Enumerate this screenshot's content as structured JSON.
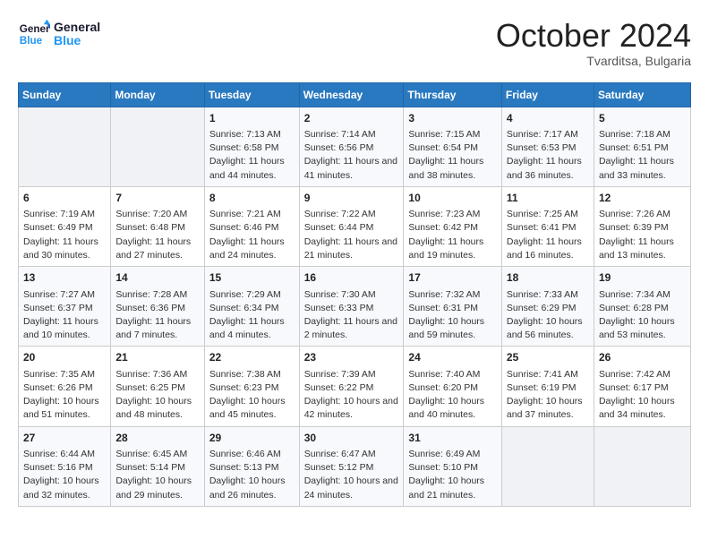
{
  "header": {
    "logo_line1": "General",
    "logo_line2": "Blue",
    "month": "October 2024",
    "location": "Tvarditsa, Bulgaria"
  },
  "weekdays": [
    "Sunday",
    "Monday",
    "Tuesday",
    "Wednesday",
    "Thursday",
    "Friday",
    "Saturday"
  ],
  "weeks": [
    [
      {
        "day": "",
        "info": ""
      },
      {
        "day": "",
        "info": ""
      },
      {
        "day": "1",
        "info": "Sunrise: 7:13 AM\nSunset: 6:58 PM\nDaylight: 11 hours and 44 minutes."
      },
      {
        "day": "2",
        "info": "Sunrise: 7:14 AM\nSunset: 6:56 PM\nDaylight: 11 hours and 41 minutes."
      },
      {
        "day": "3",
        "info": "Sunrise: 7:15 AM\nSunset: 6:54 PM\nDaylight: 11 hours and 38 minutes."
      },
      {
        "day": "4",
        "info": "Sunrise: 7:17 AM\nSunset: 6:53 PM\nDaylight: 11 hours and 36 minutes."
      },
      {
        "day": "5",
        "info": "Sunrise: 7:18 AM\nSunset: 6:51 PM\nDaylight: 11 hours and 33 minutes."
      }
    ],
    [
      {
        "day": "6",
        "info": "Sunrise: 7:19 AM\nSunset: 6:49 PM\nDaylight: 11 hours and 30 minutes."
      },
      {
        "day": "7",
        "info": "Sunrise: 7:20 AM\nSunset: 6:48 PM\nDaylight: 11 hours and 27 minutes."
      },
      {
        "day": "8",
        "info": "Sunrise: 7:21 AM\nSunset: 6:46 PM\nDaylight: 11 hours and 24 minutes."
      },
      {
        "day": "9",
        "info": "Sunrise: 7:22 AM\nSunset: 6:44 PM\nDaylight: 11 hours and 21 minutes."
      },
      {
        "day": "10",
        "info": "Sunrise: 7:23 AM\nSunset: 6:42 PM\nDaylight: 11 hours and 19 minutes."
      },
      {
        "day": "11",
        "info": "Sunrise: 7:25 AM\nSunset: 6:41 PM\nDaylight: 11 hours and 16 minutes."
      },
      {
        "day": "12",
        "info": "Sunrise: 7:26 AM\nSunset: 6:39 PM\nDaylight: 11 hours and 13 minutes."
      }
    ],
    [
      {
        "day": "13",
        "info": "Sunrise: 7:27 AM\nSunset: 6:37 PM\nDaylight: 11 hours and 10 minutes."
      },
      {
        "day": "14",
        "info": "Sunrise: 7:28 AM\nSunset: 6:36 PM\nDaylight: 11 hours and 7 minutes."
      },
      {
        "day": "15",
        "info": "Sunrise: 7:29 AM\nSunset: 6:34 PM\nDaylight: 11 hours and 4 minutes."
      },
      {
        "day": "16",
        "info": "Sunrise: 7:30 AM\nSunset: 6:33 PM\nDaylight: 11 hours and 2 minutes."
      },
      {
        "day": "17",
        "info": "Sunrise: 7:32 AM\nSunset: 6:31 PM\nDaylight: 10 hours and 59 minutes."
      },
      {
        "day": "18",
        "info": "Sunrise: 7:33 AM\nSunset: 6:29 PM\nDaylight: 10 hours and 56 minutes."
      },
      {
        "day": "19",
        "info": "Sunrise: 7:34 AM\nSunset: 6:28 PM\nDaylight: 10 hours and 53 minutes."
      }
    ],
    [
      {
        "day": "20",
        "info": "Sunrise: 7:35 AM\nSunset: 6:26 PM\nDaylight: 10 hours and 51 minutes."
      },
      {
        "day": "21",
        "info": "Sunrise: 7:36 AM\nSunset: 6:25 PM\nDaylight: 10 hours and 48 minutes."
      },
      {
        "day": "22",
        "info": "Sunrise: 7:38 AM\nSunset: 6:23 PM\nDaylight: 10 hours and 45 minutes."
      },
      {
        "day": "23",
        "info": "Sunrise: 7:39 AM\nSunset: 6:22 PM\nDaylight: 10 hours and 42 minutes."
      },
      {
        "day": "24",
        "info": "Sunrise: 7:40 AM\nSunset: 6:20 PM\nDaylight: 10 hours and 40 minutes."
      },
      {
        "day": "25",
        "info": "Sunrise: 7:41 AM\nSunset: 6:19 PM\nDaylight: 10 hours and 37 minutes."
      },
      {
        "day": "26",
        "info": "Sunrise: 7:42 AM\nSunset: 6:17 PM\nDaylight: 10 hours and 34 minutes."
      }
    ],
    [
      {
        "day": "27",
        "info": "Sunrise: 6:44 AM\nSunset: 5:16 PM\nDaylight: 10 hours and 32 minutes."
      },
      {
        "day": "28",
        "info": "Sunrise: 6:45 AM\nSunset: 5:14 PM\nDaylight: 10 hours and 29 minutes."
      },
      {
        "day": "29",
        "info": "Sunrise: 6:46 AM\nSunset: 5:13 PM\nDaylight: 10 hours and 26 minutes."
      },
      {
        "day": "30",
        "info": "Sunrise: 6:47 AM\nSunset: 5:12 PM\nDaylight: 10 hours and 24 minutes."
      },
      {
        "day": "31",
        "info": "Sunrise: 6:49 AM\nSunset: 5:10 PM\nDaylight: 10 hours and 21 minutes."
      },
      {
        "day": "",
        "info": ""
      },
      {
        "day": "",
        "info": ""
      }
    ]
  ]
}
